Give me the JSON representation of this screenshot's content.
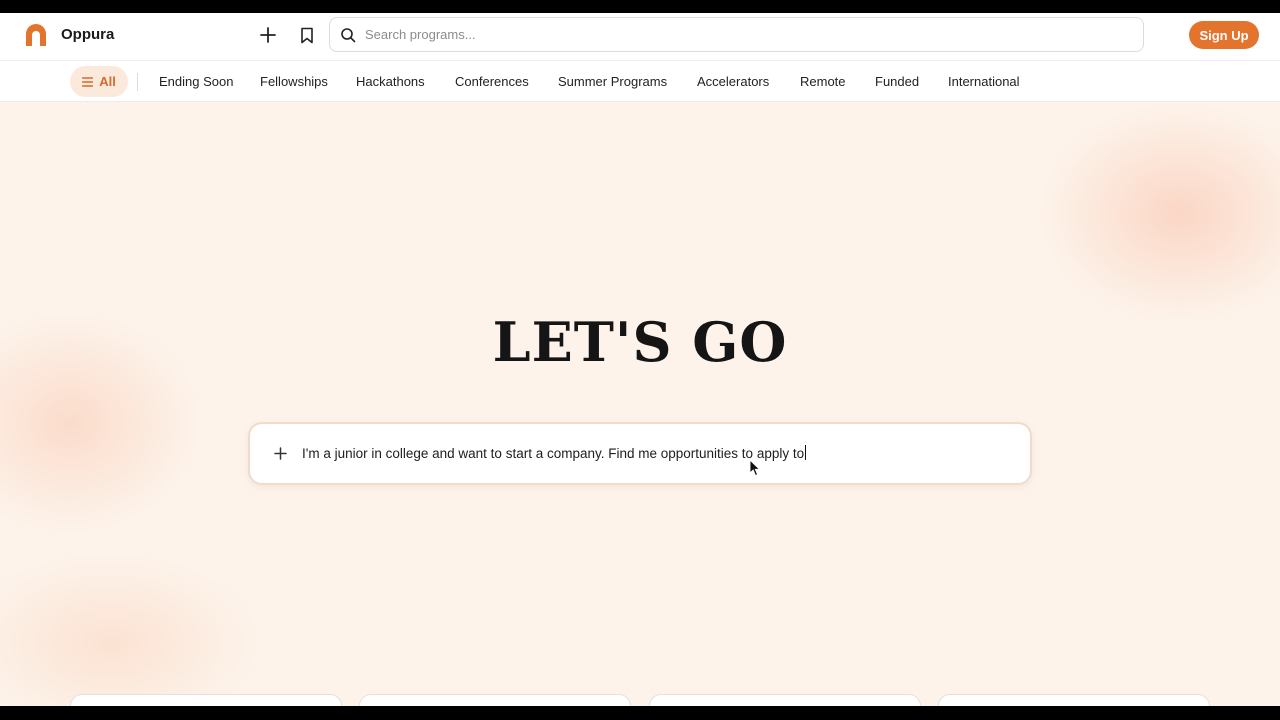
{
  "header": {
    "brand": "Oppura",
    "search_placeholder": "Search programs...",
    "signup_label": "Sign Up",
    "icons": [
      "logo-arch-icon",
      "plus-icon",
      "bookmark-icon",
      "search-icon"
    ]
  },
  "categories": {
    "all_label": "All",
    "items": [
      "Ending Soon",
      "Fellowships",
      "Hackathons",
      "Conferences",
      "Summer Programs",
      "Accelerators",
      "Remote",
      "Funded",
      "International"
    ]
  },
  "hero": {
    "title": "LET'S GO",
    "prompt_text": "I'm a junior in college and want to start a company. Find me opportunities to apply to"
  },
  "colors": {
    "accent": "#e2742d",
    "background": "#fdf3ea",
    "all_pill": "#fbe9dc"
  }
}
